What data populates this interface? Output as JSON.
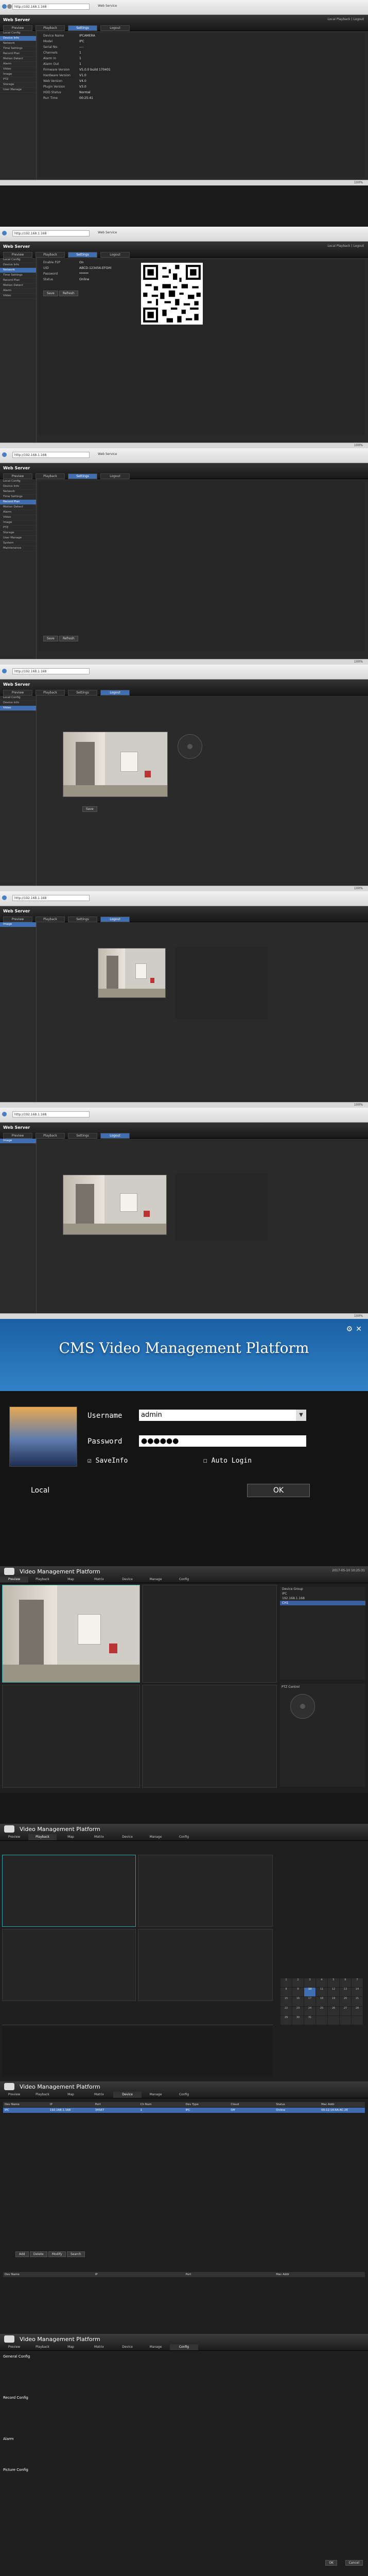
{
  "browser": {
    "address": "http://192.168.1.168",
    "page_title": "Web Service",
    "status_zoom": "100%"
  },
  "web": {
    "logo": "Web Server",
    "logout": "Local Playback | Logout",
    "tabs": [
      "Preview",
      "Playback",
      "Settings",
      "Logout"
    ],
    "sidebar": [
      "Local Config",
      "Device Info",
      "Network",
      "Time Settings",
      "Record Plan",
      "Motion Detect",
      "Alarm",
      "Video",
      "Image",
      "PTZ",
      "Storage",
      "User Manage",
      "System",
      "Maintenance",
      "Log",
      "Reboot"
    ],
    "device_info": [
      {
        "label": "Device Name",
        "value": "IPCAMERA"
      },
      {
        "label": "Model",
        "value": "IPC"
      },
      {
        "label": "Serial No.",
        "value": "----"
      },
      {
        "label": "Channels",
        "value": "1"
      },
      {
        "label": "Alarm In",
        "value": "1"
      },
      {
        "label": "Alarm Out",
        "value": "1"
      },
      {
        "label": "Firmware Version",
        "value": "V5.0.0 build 170401"
      },
      {
        "label": "Hardware Version",
        "value": "V1.0"
      },
      {
        "label": "Web Version",
        "value": "V4.0"
      },
      {
        "label": "Plugin Version",
        "value": "V3.0"
      },
      {
        "label": "HDD Status",
        "value": "Normal"
      },
      {
        "label": "Run Time",
        "value": "00:25:41"
      }
    ],
    "p2p_fields": [
      {
        "label": "Enable P2P",
        "value": "On"
      },
      {
        "label": "UID",
        "value": "ABCD-123456-EFGHI"
      },
      {
        "label": "Password",
        "value": "******"
      },
      {
        "label": "Status",
        "value": "Online"
      }
    ],
    "save": "Save",
    "refresh": "Refresh",
    "ptz_labels": [
      "Zoom",
      "Focus",
      "Iris"
    ],
    "preset": "Preset"
  },
  "cms": {
    "title": "CMS Video Management Platform",
    "username_label": "Username",
    "username_value": "admin",
    "password_label": "Password",
    "password_value": "●●●●●●",
    "save_info": "SaveInfo",
    "auto_login": "Auto Login",
    "local": "Local",
    "ok": "OK"
  },
  "vmp": {
    "title": "Video Management Platform",
    "menu": [
      "Preview",
      "Playback",
      "Map",
      "Matrix",
      "Device",
      "Manage",
      "Config"
    ],
    "clock": "2017-05-10 10:25:31",
    "tree": [
      "Device Group",
      "IPC",
      "192.168.1.168",
      "CH1"
    ],
    "ptz_title": "PTZ Control",
    "table_headers": [
      "Dev Name",
      "IP",
      "Port",
      "Ch Num",
      "Dev Type",
      "Cloud",
      "Status",
      "Mac Addr"
    ],
    "table_row": [
      "IPC",
      "192.168.1.168",
      "34567",
      "1",
      "IPC",
      "Off",
      "Online",
      "00:12:16:6A:AC:2E"
    ],
    "config_sections": [
      "General Config",
      "Record Config",
      "Alarm",
      "Picture Config"
    ],
    "buttons": [
      "Add",
      "Delete",
      "Modify",
      "Search"
    ],
    "ok": "OK",
    "cancel": "Cancel"
  }
}
